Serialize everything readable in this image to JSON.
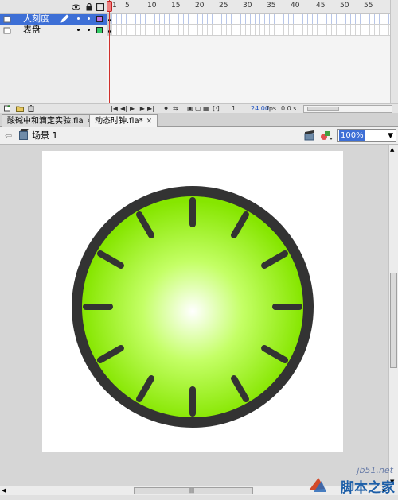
{
  "timeline": {
    "header_icons": [
      "eye-icon",
      "lock-icon",
      "outline-icon"
    ],
    "frame_labels": [
      "1",
      "5",
      "10",
      "15",
      "20",
      "25",
      "30",
      "35",
      "40",
      "45",
      "50",
      "55"
    ],
    "layers": [
      {
        "name": "大刻度",
        "selected": true,
        "color": "#c070e0"
      },
      {
        "name": "表盘",
        "selected": false,
        "color": "#33cc66"
      }
    ],
    "current_frame": "1",
    "frame_rate": "24.00",
    "fps_label": "fps",
    "elapsed": "0.0 s"
  },
  "doc_tabs": [
    {
      "label": "酸碱中和滴定实验.fla",
      "active": false
    },
    {
      "label": "动态时钟.fla*",
      "active": true
    }
  ],
  "edit_bar": {
    "scene": "场景 1",
    "zoom": "100%"
  },
  "clock": {
    "outer_color": "#333333",
    "gradient_center": "#ffffff",
    "gradient_mid": "#c4ff66",
    "gradient_edge": "#86e600",
    "tick_color": "#333333",
    "tick_count": 12
  },
  "watermark": {
    "url": "jb51.net",
    "name": "脚本之家"
  }
}
